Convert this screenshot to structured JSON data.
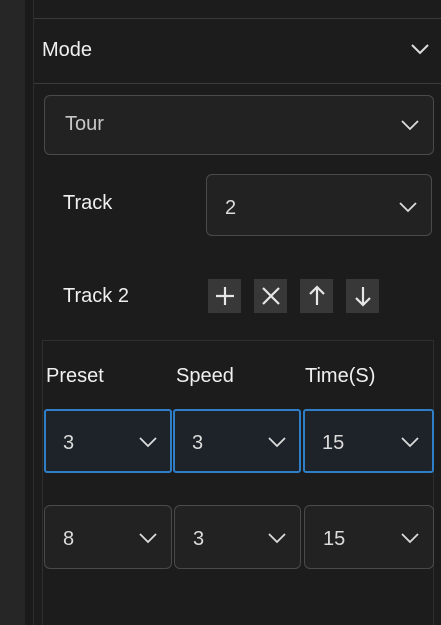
{
  "mode": {
    "label": "Mode"
  },
  "tour": {
    "value": "Tour"
  },
  "track": {
    "label": "Track",
    "value": "2"
  },
  "track_list": {
    "label": "Track 2"
  },
  "table": {
    "headers": [
      "Preset",
      "Speed",
      "Time(S)"
    ],
    "rows": [
      {
        "preset": "3",
        "speed": "3",
        "time": "15",
        "selected": true
      },
      {
        "preset": "8",
        "speed": "3",
        "time": "15",
        "selected": false
      }
    ]
  },
  "colors": {
    "selected_border": "#2f7fc8",
    "panel_bg": "#1c1c1c",
    "button_bg": "#383838"
  },
  "icons": [
    "chevron-down-icon",
    "plus-icon",
    "close-icon",
    "arrow-up-icon",
    "arrow-down-icon"
  ]
}
